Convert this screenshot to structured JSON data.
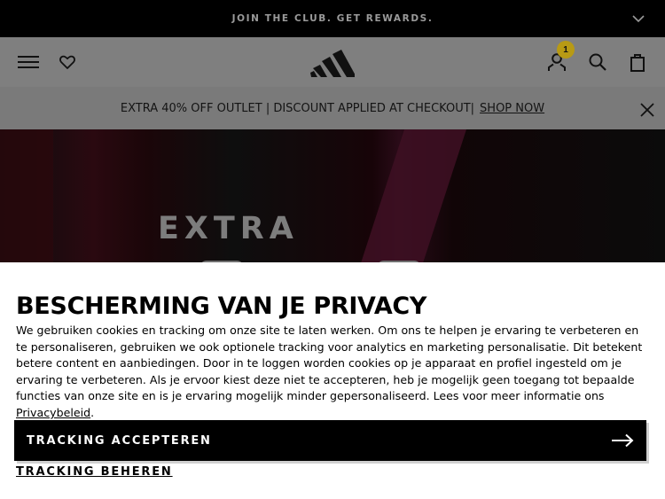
{
  "top_bar": {
    "text": "JOIN THE CLUB. GET REWARDS."
  },
  "header": {
    "cart_badge": "1"
  },
  "outlet_banner": {
    "text": "EXTRA 40% OFF OUTLET | DISCOUNT APPLIED AT CHECKOUT|",
    "link": "SHOP NOW"
  },
  "hero": {
    "text": "EXTRA"
  },
  "privacy": {
    "title": "BESCHERMING VAN JE PRIVACY",
    "body": "We gebruiken cookies en tracking om onze site te laten werken. Om ons te helpen je ervaring te verbeteren en te personaliseren, gebruiken we ook optionele tracking voor analytics en marketing personalisatie. Dit betekent betere content en aanbiedingen. Door in te loggen worden cookies op je apparaat en profiel ingesteld om je ervaring te verbeteren. Als je ervoor kiest deze niet te accepteren, heb je mogelijk geen toegang tot bepaalde functies van onze site en is je ervaring mogelijk minder gepersonaliseerd. Lees voor meer informatie ons ",
    "policy_link": "Privacybeleid",
    "body_end": ".",
    "accept_label": "TRACKING ACCEPTEREN",
    "manage_label": "TRACKING BEHEREN"
  },
  "icons": {
    "top": "chevron-down-icon",
    "header": [
      "menu-icon",
      "heart-icon",
      "adidas-logo",
      "account-icon",
      "search-icon",
      "bag-icon"
    ],
    "banner": "close-icon",
    "button": "arrow-right-icon"
  },
  "colors": {
    "badge": "#b89a14",
    "overlay": "#7f7f7f",
    "button": "#000000"
  }
}
